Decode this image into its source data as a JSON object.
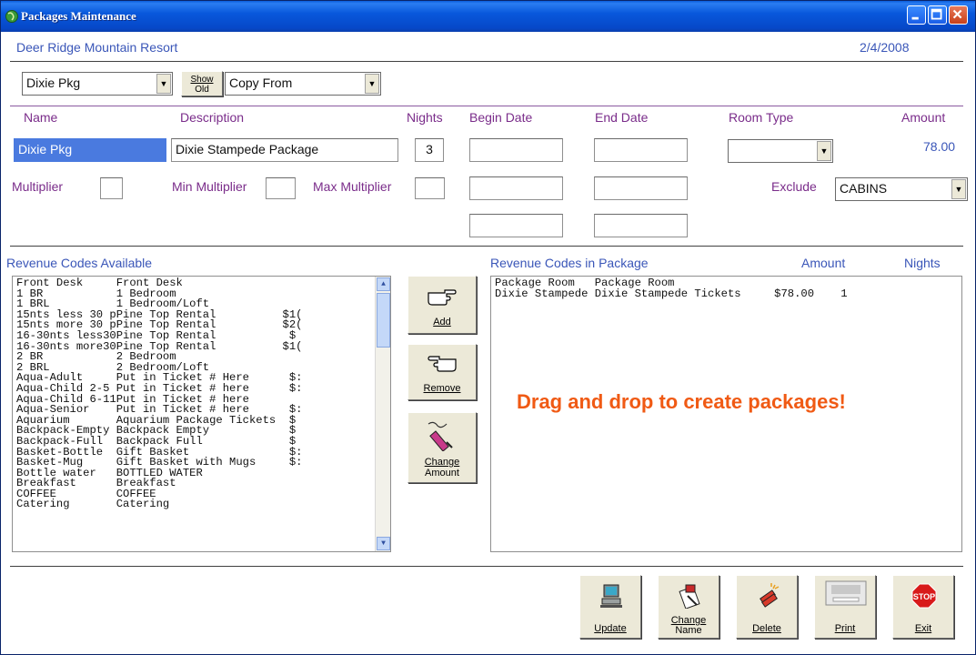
{
  "window": {
    "title": "Packages  Maintenance"
  },
  "header": {
    "resort": "Deer Ridge Mountain Resort",
    "date": "2/4/2008"
  },
  "toolbar": {
    "package_select": "Dixie Pkg",
    "show_old_line1": "Show",
    "show_old_line2": "Old",
    "copy_from": "Copy From"
  },
  "columns": {
    "name": "Name",
    "description": "Description",
    "nights": "Nights",
    "begin_date": "Begin Date",
    "end_date": "End Date",
    "room_type": "Room Type",
    "amount": "Amount"
  },
  "form": {
    "name": "Dixie Pkg",
    "description": "Dixie Stampede Package",
    "nights": "3",
    "room_type": "",
    "amount": "78.00",
    "multiplier_label": "Multiplier",
    "min_multiplier_label": "Min Multiplier",
    "max_multiplier_label": "Max Multiplier",
    "exclude_label": "Exclude",
    "exclude_value": "CABINS"
  },
  "available": {
    "title": "Revenue Codes Available",
    "rows": [
      "Front Desk     Front Desk",
      "1 BR           1 Bedroom",
      "1 BRL          1 Bedroom/Loft",
      "15nts less 30 pPine Top Rental          $1(",
      "15nts more 30 pPine Top Rental          $2(",
      "16-30nts less30Pine Top Rental           $",
      "16-30nts more30Pine Top Rental          $1(",
      "2 BR           2 Bedroom",
      "2 BRL          2 Bedroom/Loft",
      "Aqua-Adult     Put in Ticket # Here      $:",
      "Aqua-Child 2-5 Put in Ticket # here      $:",
      "Aqua-Child 6-11Put in Ticket # here",
      "Aqua-Senior    Put in Ticket # here      $:",
      "Aquarium       Aquarium Package Tickets  $",
      "Backpack-Empty Backpack Empty            $",
      "Backpack-Full  Backpack Full             $",
      "Basket-Bottle  Gift Basket               $:",
      "Basket-Mug     Gift Basket with Mugs     $:",
      "Bottle water   BOTTLED WATER",
      "Breakfast      Breakfast",
      "COFFEE         COFFEE",
      "Catering       Catering"
    ]
  },
  "actions": {
    "add": "Add",
    "remove": "Remove",
    "change_line1": "Change",
    "change_line2": "Amount"
  },
  "in_package": {
    "title": "Revenue Codes in Package",
    "amount_header": "Amount",
    "nights_header": "Nights",
    "rows": [
      "Package Room   Package Room",
      "Dixie Stampede Dixie Stampede Tickets     $78.00    1"
    ]
  },
  "promo": "Drag and drop to create packages!",
  "bottom": {
    "update": "Update",
    "change_name_line1": "Change",
    "change_name_line2": "Name",
    "delete": "Delete",
    "print": "Print",
    "exit": "Exit",
    "stop_sign": "STOP"
  }
}
